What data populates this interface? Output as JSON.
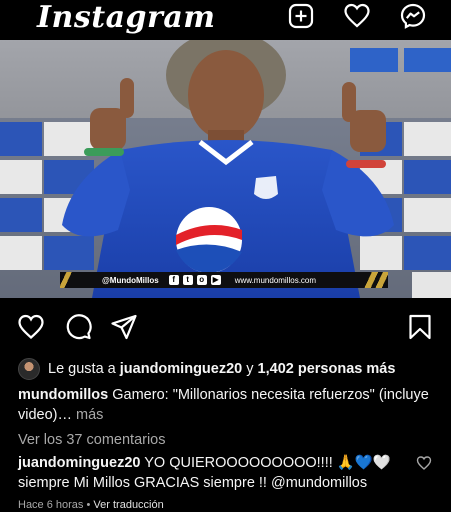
{
  "app": {
    "title": "Instagram"
  },
  "header": {
    "icons": [
      "new-post-icon",
      "heart-icon",
      "messenger-icon"
    ]
  },
  "post": {
    "banner": {
      "handle": "@MundoMillos",
      "social_glyphs": [
        "f",
        "t",
        "o",
        "▶"
      ],
      "site": "www.mundomillos.com"
    },
    "likes": {
      "prefix": "Le gusta a",
      "user": "juandominguez20",
      "connector": "y",
      "count": "1,402 personas más"
    },
    "caption": {
      "author": "mundomillos",
      "text": "Gamero: \"Millonarios necesita refuerzos\" (incluye video)…",
      "more": "más"
    },
    "view_comments": "Ver los 37 comentarios",
    "comment": {
      "author": "juandominguez20",
      "text": "YO QUIEROOOOOOOOO!!!! 🙏💙🤍 siempre Mi Millos GRACIAS siempre !! @mundomillos"
    },
    "time_ago": "Hace 6 horas",
    "separator": "•",
    "translate": "Ver traducción"
  }
}
